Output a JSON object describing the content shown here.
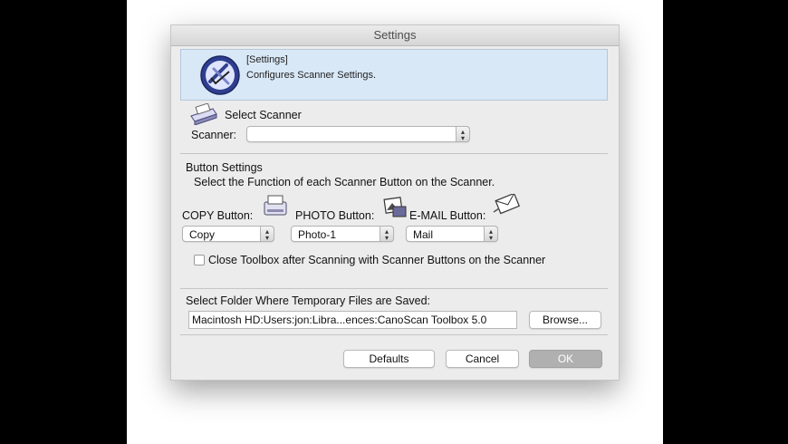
{
  "window": {
    "title": "Settings"
  },
  "banner": {
    "heading": "[Settings]",
    "description": "Configures Scanner Settings."
  },
  "scanner": {
    "section_title": "Select Scanner",
    "label": "Scanner:",
    "value": ""
  },
  "button_settings": {
    "title": "Button Settings",
    "subtitle": "Select the Function of each Scanner Button on the Scanner.",
    "copy": {
      "label": "COPY Button:",
      "value": "Copy"
    },
    "photo": {
      "label": "PHOTO Button:",
      "value": "Photo-1"
    },
    "email": {
      "label": "E-MAIL Button:",
      "value": "Mail"
    },
    "close_toolbox_label": "Close Toolbox after Scanning with Scanner Buttons on the Scanner",
    "close_toolbox_checked": false
  },
  "folder": {
    "label": "Select Folder Where Temporary Files are Saved:",
    "path": "Macintosh HD:Users:jon:Libra...ences:CanoScan Toolbox 5.0",
    "browse_label": "Browse..."
  },
  "footer": {
    "defaults_label": "Defaults",
    "cancel_label": "Cancel",
    "ok_label": "OK"
  },
  "colors": {
    "banner_bg": "#d9e8f7",
    "ok_button": "#b0b0b0"
  }
}
